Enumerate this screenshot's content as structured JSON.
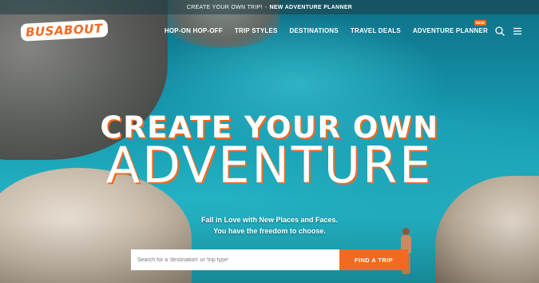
{
  "banner": {
    "part1": "CREATE YOUR OWN TRIP!",
    "separator": "-",
    "part2": "NEW ADVENTURE PLANNER"
  },
  "header": {
    "logo": "BUSABOUT",
    "nav": [
      {
        "label": "HOP-ON HOP-OFF"
      },
      {
        "label": "TRIP STYLES"
      },
      {
        "label": "DESTINATIONS"
      },
      {
        "label": "TRAVEL DEALS"
      },
      {
        "label": "ADVENTURE PLANNER",
        "badge": "NEW"
      }
    ],
    "icons": [
      "search-icon",
      "menu-icon"
    ]
  },
  "hero": {
    "title_line1": "CREATE YOUR OWN",
    "title_line2": "ADVENTURE",
    "subtitle_line1": "Fall in Love with New Places and Faces.",
    "subtitle_line2": "You have the freedom to choose."
  },
  "search": {
    "placeholder": "Search for a 'destination' or 'trip type'",
    "button_label": "FIND A TRIP"
  },
  "colors": {
    "accent": "#f26a21",
    "water": "#1a8fa0"
  }
}
